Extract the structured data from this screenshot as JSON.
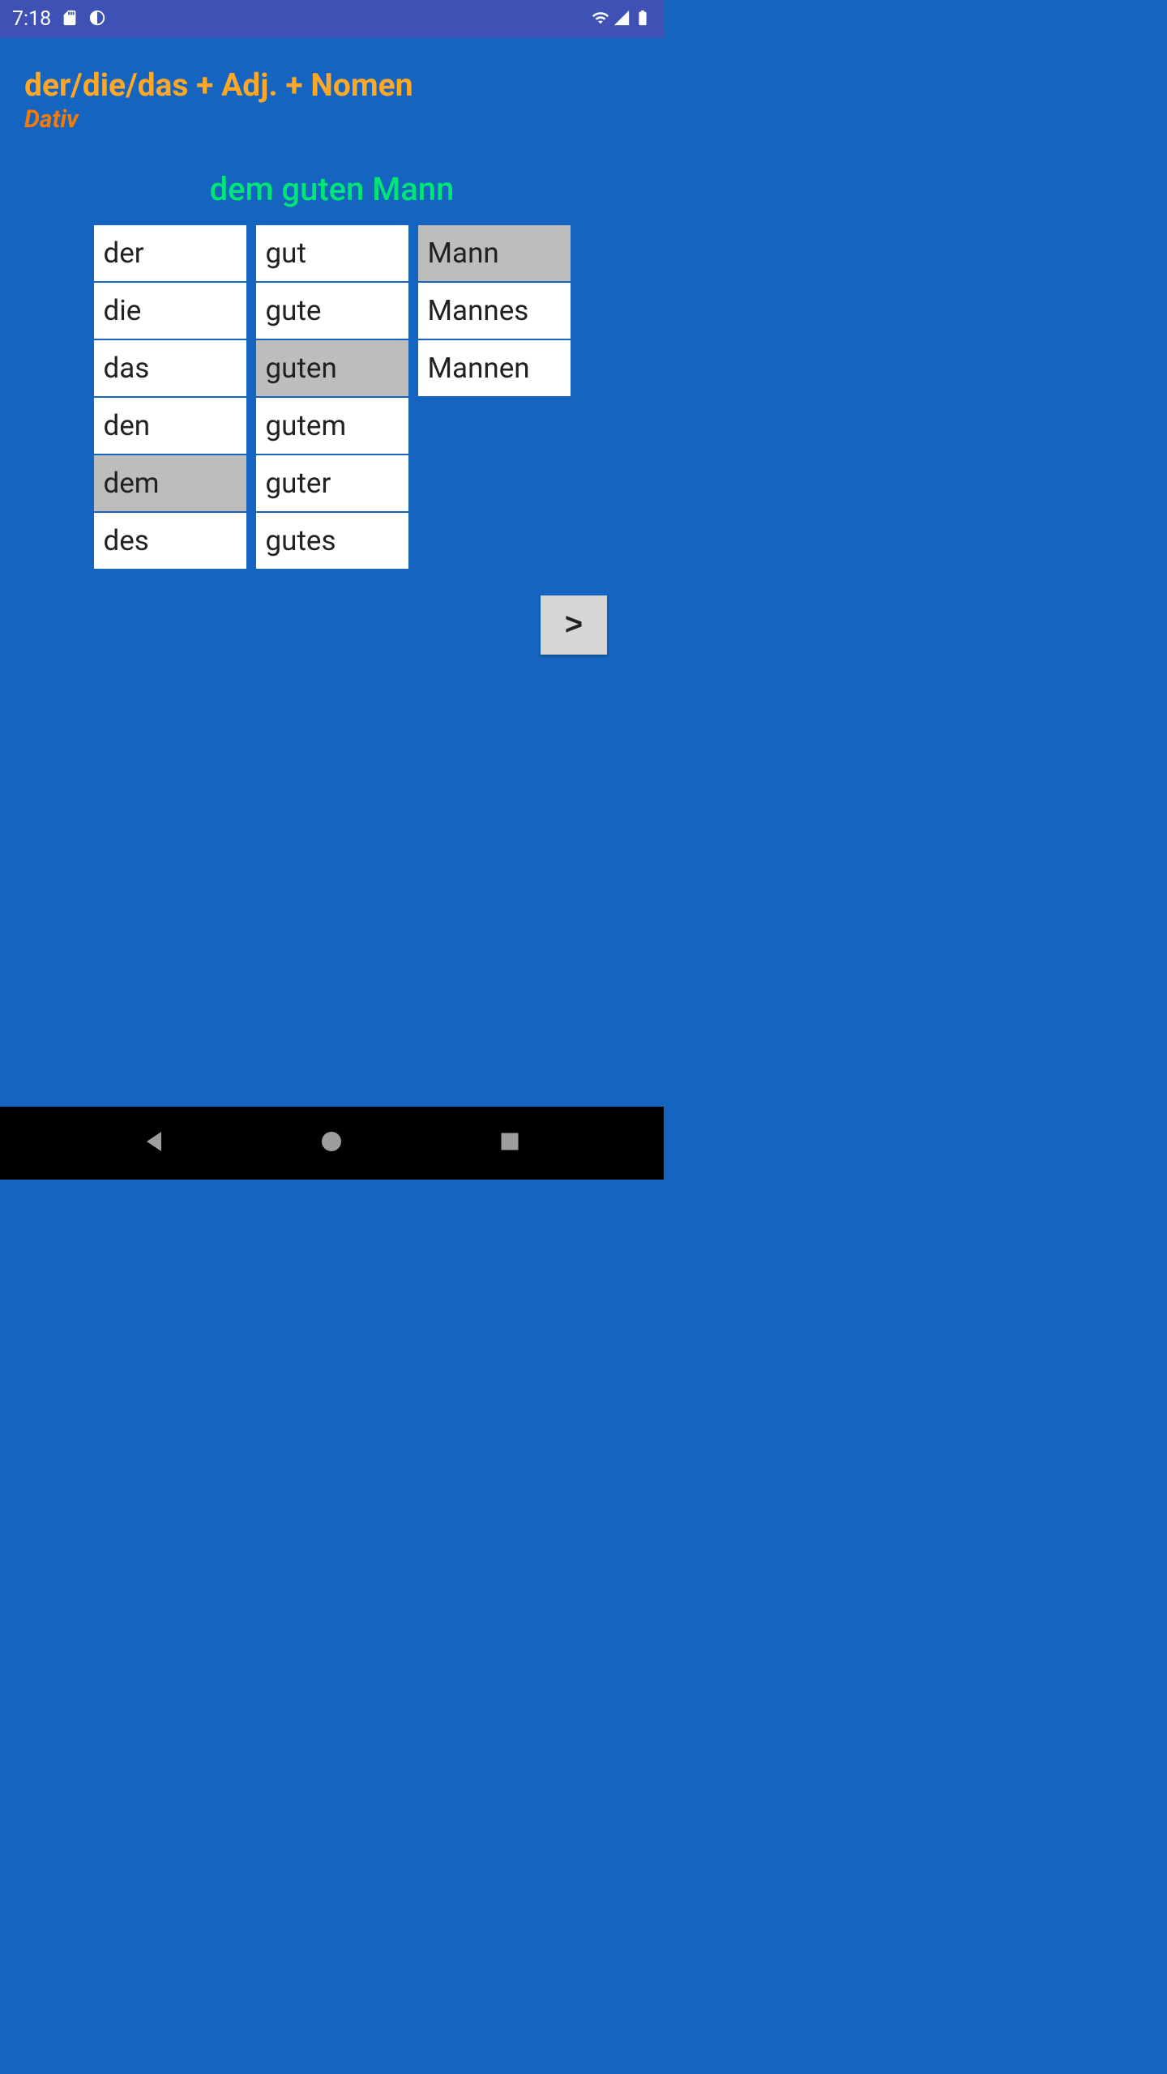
{
  "status_bar": {
    "time": "7:18"
  },
  "header": {
    "title": "der/die/das + Adj. + Nomen",
    "subtitle": "Dativ"
  },
  "answer": "dem  guten  Mann",
  "columns": [
    {
      "items": [
        {
          "label": "der",
          "selected": false
        },
        {
          "label": "die",
          "selected": false
        },
        {
          "label": "das",
          "selected": false
        },
        {
          "label": "den",
          "selected": false
        },
        {
          "label": "dem",
          "selected": true
        },
        {
          "label": "des",
          "selected": false
        }
      ]
    },
    {
      "items": [
        {
          "label": "gut",
          "selected": false
        },
        {
          "label": "gute",
          "selected": false
        },
        {
          "label": "guten",
          "selected": true
        },
        {
          "label": "gutem",
          "selected": false
        },
        {
          "label": "guter",
          "selected": false
        },
        {
          "label": "gutes",
          "selected": false
        }
      ]
    },
    {
      "items": [
        {
          "label": "Mann",
          "selected": true
        },
        {
          "label": "Mannes",
          "selected": false
        },
        {
          "label": "Mannen",
          "selected": false
        }
      ]
    }
  ],
  "next_button": ">"
}
